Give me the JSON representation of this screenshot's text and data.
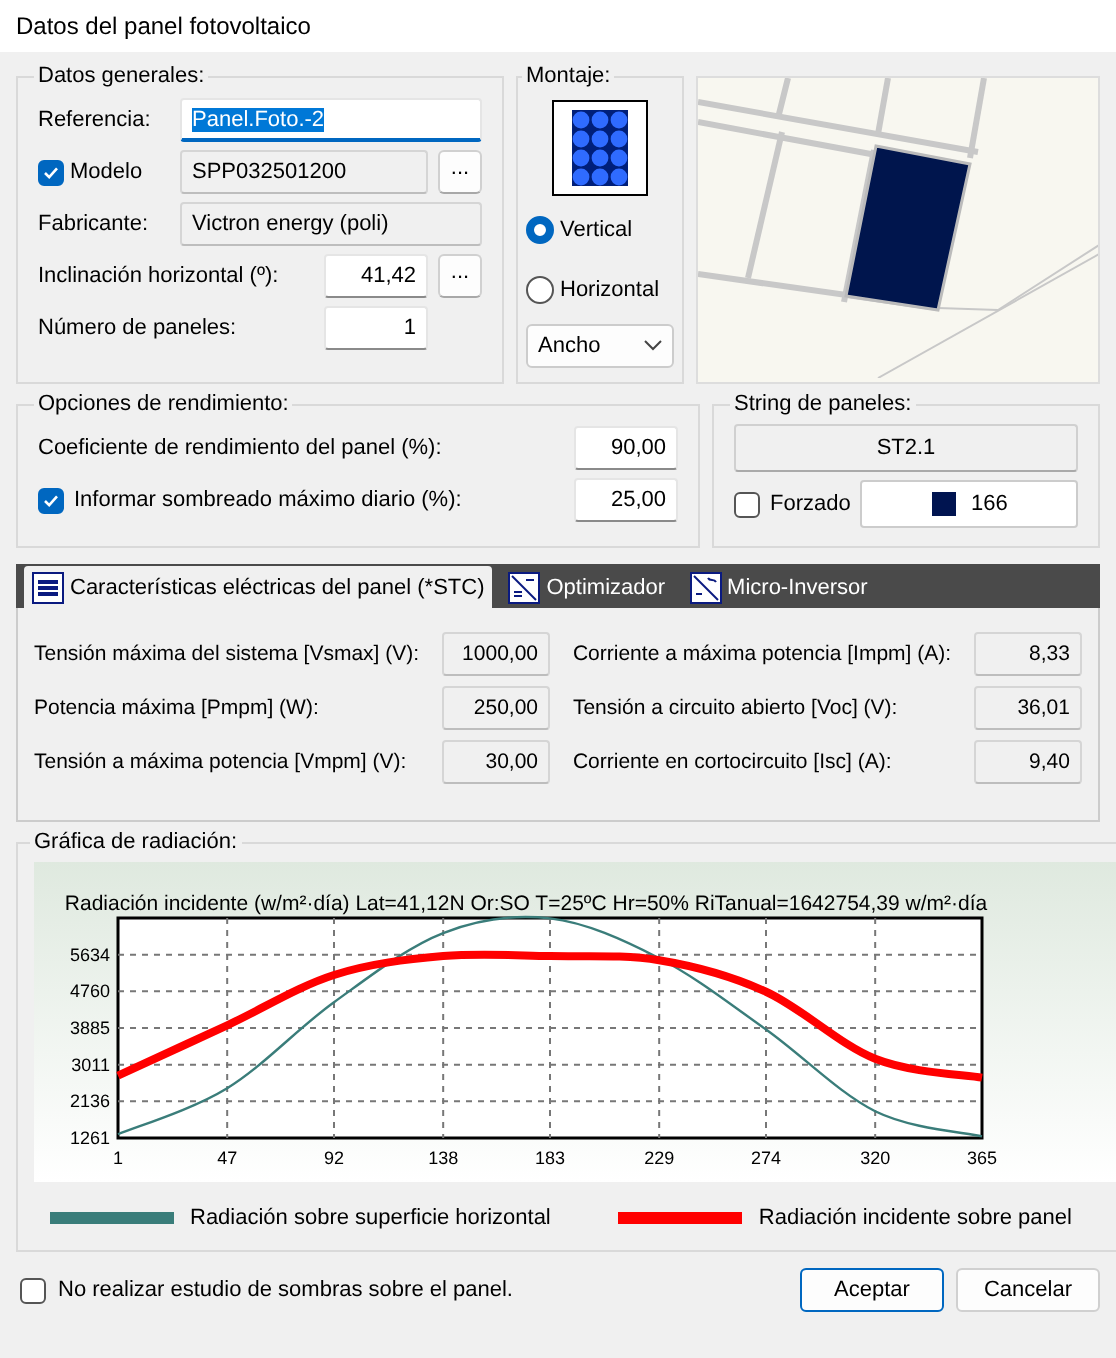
{
  "window": {
    "title": "Datos del panel fotovoltaico"
  },
  "general": {
    "title": "Datos generales:",
    "fields": [
      {
        "kind": "text",
        "label": "Referencia:",
        "value": "Panel.Foto.-2",
        "focused": true
      },
      {
        "kind": "check",
        "label": "Modelo",
        "checked": true,
        "value": "SPP032501200",
        "button": "..."
      },
      {
        "kind": "readonly",
        "label": "Fabricante:",
        "value": "Victron energy (poli)"
      },
      {
        "kind": "number",
        "label": "Inclinación horizontal (º):",
        "value": "41,42",
        "button": "..."
      },
      {
        "kind": "number",
        "label": "Número de paneles:",
        "value": "1"
      }
    ]
  },
  "mounting": {
    "title": "Montaje:",
    "options": [
      {
        "label": "Vertical",
        "selected": true
      },
      {
        "label": "Horizontal",
        "selected": false
      }
    ],
    "dropdown": "Ancho"
  },
  "performance": {
    "title": "Opciones de rendimiento:",
    "rows": [
      {
        "kind": "plain",
        "label": "Coeficiente de rendimiento del panel (%):",
        "value": "90,00"
      },
      {
        "kind": "check",
        "label": "Informar sombreado máximo diario (%):",
        "value": "25,00",
        "checked": true
      }
    ]
  },
  "string": {
    "title": "String de paneles:",
    "name": "ST2.1",
    "forced": {
      "label": "Forzado",
      "checked": false
    },
    "color": "#001450",
    "number": "166"
  },
  "tabs": [
    {
      "label": "Características eléctricas del panel (*STC)",
      "selected": true
    },
    {
      "label": "Optimizador",
      "selected": false
    },
    {
      "label": "Micro-Inversor",
      "selected": false
    }
  ],
  "electrical": {
    "rows": [
      {
        "label": "Tensión máxima del sistema [Vsmax] (V):",
        "value": "1000,00"
      },
      {
        "label": "Corriente a máxima potencia [Impm] (A):",
        "value": "8,33"
      },
      {
        "label": "Potencia máxima [Pmpm] (W):",
        "value": "250,00"
      },
      {
        "label": "Tensión a circuito abierto [Voc] (V):",
        "value": "36,01"
      },
      {
        "label": "Tensión a máxima potencia [Vmpm] (V):",
        "value": "30,00"
      },
      {
        "label": "Corriente en cortocircuito [Isc] (A):",
        "value": "9,40"
      }
    ]
  },
  "radiation": {
    "title": "Gráfica de radiación:",
    "chart_data": {
      "type": "line",
      "title": "Radiación incidente (w/m²·día) Lat=41,12N Or:SO T=25ºC Hr=50% RiTanual=1642754,39 w/m²·día",
      "x": [
        1,
        47,
        92,
        138,
        183,
        229,
        274,
        320,
        365
      ],
      "series": [
        {
          "name": "Radiación sobre superficie horizontal",
          "color": "#3a7d7a",
          "values": [
            1350,
            2450,
            4500,
            6150,
            6500,
            5550,
            3850,
            1900,
            1300
          ]
        },
        {
          "name": "Radiación incidente sobre panel",
          "color": "#ff0000",
          "values": [
            2750,
            3950,
            5150,
            5600,
            5600,
            5500,
            4750,
            3150,
            2700
          ]
        }
      ],
      "grid": true,
      "xlim": [
        1,
        365
      ],
      "ylim": [
        1261,
        6509
      ],
      "xticks": [
        1,
        47,
        92,
        138,
        183,
        229,
        274,
        320,
        365
      ],
      "yticks": [
        1261,
        2136,
        3011,
        3885,
        4760,
        5634
      ]
    }
  },
  "footer": {
    "no_shadow": {
      "label": "No realizar estudio de sombras sobre el panel.",
      "checked": false
    },
    "buttons": [
      {
        "label": "Aceptar",
        "default": true
      },
      {
        "label": "Cancelar",
        "default": false
      }
    ]
  }
}
